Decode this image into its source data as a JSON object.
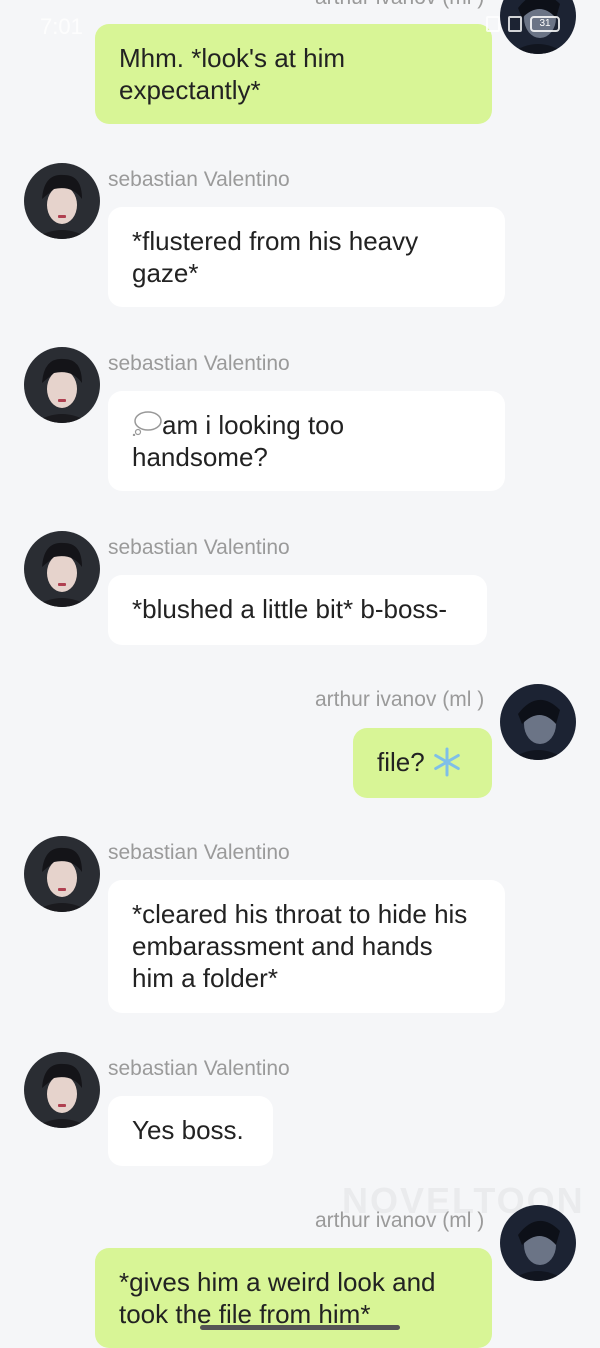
{
  "status_bar": {
    "time": "7:01",
    "battery": "31"
  },
  "top_name": "arthur ivanov (ml )",
  "messages": [
    {
      "role": "user",
      "text": "Mhm. *look's at him expectantly*"
    },
    {
      "role": "bot",
      "name": "sebastian Valentino",
      "text": "*flustered from his heavy gaze*"
    },
    {
      "role": "bot",
      "name": "sebastian Valentino",
      "text": "am i looking too handsome?",
      "emoji": "thought-balloon"
    },
    {
      "role": "bot",
      "name": "sebastian Valentino",
      "text": "*blushed a little bit* b-boss-"
    },
    {
      "role": "user",
      "name": "arthur ivanov (ml )",
      "text": "file?",
      "emoji": "snowflake"
    },
    {
      "role": "bot",
      "name": "sebastian Valentino",
      "text": "*cleared his throat to hide his embarassment and hands him a folder*"
    },
    {
      "role": "bot",
      "name": "sebastian Valentino",
      "text": "Yes boss."
    },
    {
      "role": "user",
      "name": "arthur ivanov (ml )",
      "text": "*gives him a weird look and took the file from him*"
    }
  ],
  "watermark": "NOVELTOON",
  "colors": {
    "user_bubble": "#d8f596",
    "bot_bubble": "#ffffff",
    "background": "#f5f6f8",
    "name": "#9a9a9a"
  }
}
